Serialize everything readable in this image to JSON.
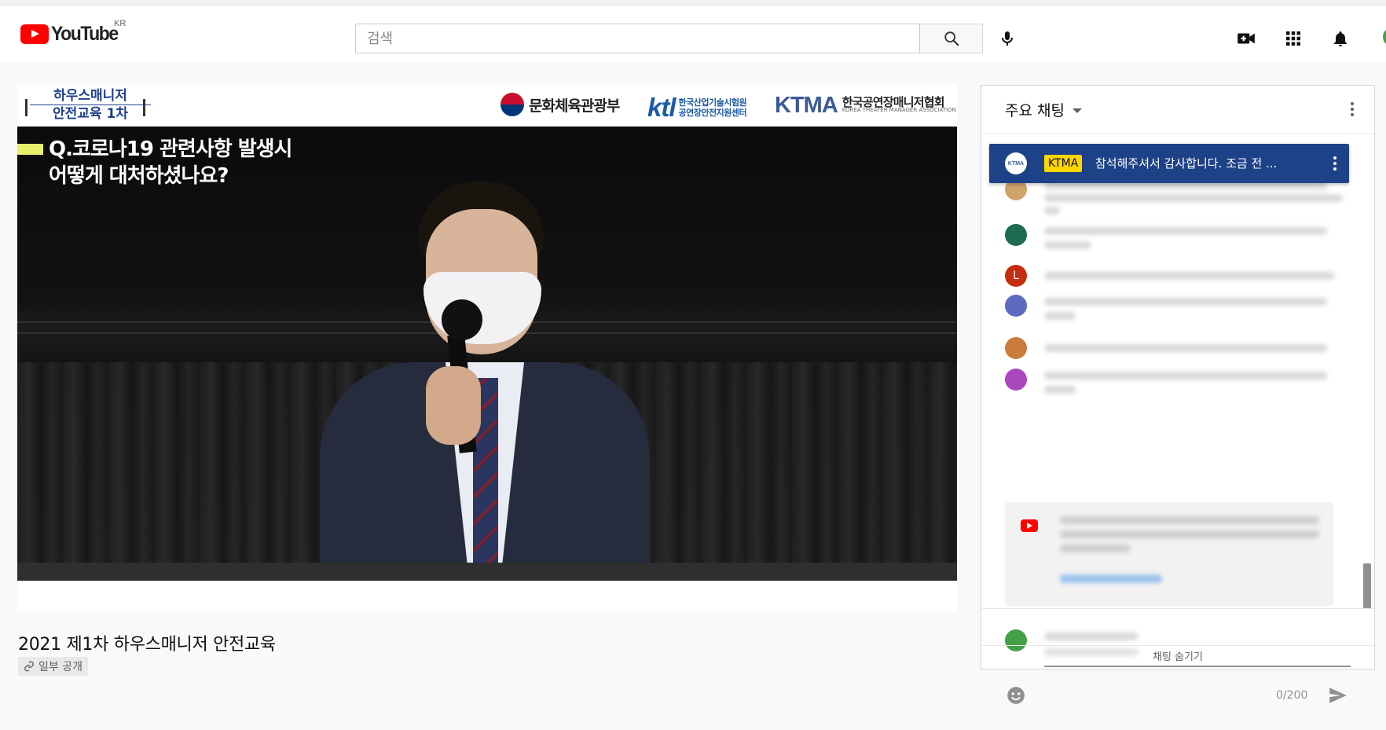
{
  "header": {
    "logo_text": "YouTube",
    "country_code": "KR",
    "search_placeholder": "검색",
    "icons": [
      "search-icon",
      "mic-icon",
      "video-camera-icon",
      "apps-grid-icon",
      "bell-icon"
    ]
  },
  "player": {
    "banner": {
      "series_title_line1": "하우스매니저",
      "series_title_line2": "안전교육 1차",
      "ministry": "문화체육관광부",
      "ktl_mark": "ktl",
      "ktl_sub_line1": "한국산업기술시험원",
      "ktl_sub_line2": "공연장안전지원센터",
      "ktma_mark": "KTMA",
      "ktma_sub_kr": "한국공연장매니저협회",
      "ktma_sub_en": "KOREA THEATER MANAGER ASSOCIATION"
    },
    "question_line1": "Q.코로나19 관련사항 발생시",
    "question_line2": "어떻게 대처하셨나요?"
  },
  "video": {
    "title": "2021 제1차 하우스매니저 안전교육",
    "privacy": "일부 공개"
  },
  "chat": {
    "mode": "주요 채팅",
    "pinned": {
      "avatar_text": "KTMA",
      "author_badge": "KTMA",
      "text": "참석해주셔서 감사합니다. 조금 전 ..."
    },
    "avatar_colors": [
      "#1e6b52",
      "#c62d0f",
      "#5c6bc0",
      "#c97c3c",
      "#ab47bc"
    ],
    "avatar_letters": [
      "",
      "L",
      "",
      "",
      ""
    ],
    "compose": {
      "counter": "0/200"
    },
    "hide_label": "채팅 숨기기"
  },
  "colors": {
    "brand_red": "#ff0000",
    "pinned_bg": "#1e4288",
    "author_badge_bg": "#ffd600",
    "question_bar": "#e6f06a"
  }
}
